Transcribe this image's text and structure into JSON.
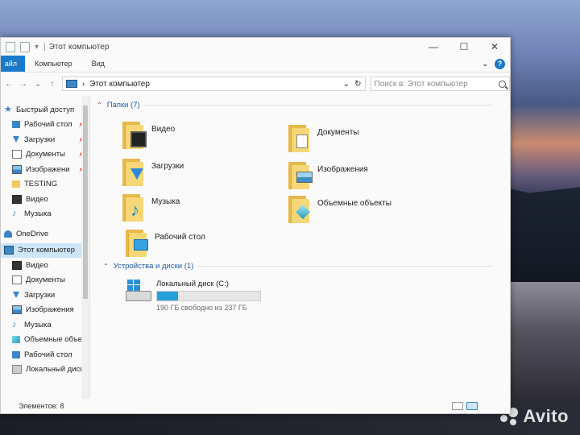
{
  "window": {
    "title": "Этот компьютер"
  },
  "ribbon": {
    "file_tab": "айл",
    "tabs": [
      "Компьютер",
      "Вид"
    ],
    "help": "?"
  },
  "address": {
    "path": "Этот компьютер"
  },
  "search": {
    "placeholder": "Поиск в: Этот компьютер"
  },
  "nav": {
    "quick_access": "Быстрый доступ",
    "quick_items": [
      {
        "label": "Рабочий стол",
        "icon": "desktop-icon"
      },
      {
        "label": "Загрузки",
        "icon": "download-icon"
      },
      {
        "label": "Документы",
        "icon": "document-icon"
      },
      {
        "label": "Изображени",
        "icon": "image-icon"
      },
      {
        "label": "TESTING",
        "icon": "folder-icon"
      },
      {
        "label": "Видео",
        "icon": "video-icon"
      },
      {
        "label": "Музыка",
        "icon": "music-icon"
      }
    ],
    "onedrive": "OneDrive",
    "this_pc": "Этот компьютер",
    "pc_items": [
      {
        "label": "Видео",
        "icon": "video-icon"
      },
      {
        "label": "Документы",
        "icon": "document-icon"
      },
      {
        "label": "Загрузки",
        "icon": "download-icon"
      },
      {
        "label": "Изображения",
        "icon": "image-icon"
      },
      {
        "label": "Музыка",
        "icon": "music-icon"
      },
      {
        "label": "Объемные объе",
        "icon": "3d-objects-icon"
      },
      {
        "label": "Рабочий стол",
        "icon": "desktop-icon"
      },
      {
        "label": "Локальный диск",
        "icon": "disk-icon"
      }
    ]
  },
  "folders_group": {
    "header": "Папки (7)"
  },
  "folders": [
    {
      "label": "Видео",
      "icon": "video-folder-icon"
    },
    {
      "label": "Документы",
      "icon": "documents-folder-icon"
    },
    {
      "label": "Загрузки",
      "icon": "downloads-folder-icon"
    },
    {
      "label": "Изображения",
      "icon": "pictures-folder-icon"
    },
    {
      "label": "Музыка",
      "icon": "music-folder-icon"
    },
    {
      "label": "Объемные объекты",
      "icon": "3d-objects-folder-icon"
    },
    {
      "label": "Рабочий стол",
      "icon": "desktop-folder-icon"
    }
  ],
  "devices_group": {
    "header": "Устройства и диски (1)"
  },
  "drive": {
    "label": "Локальный диск (C:)",
    "free_text": "190 ГБ свободно из 237 ГБ",
    "used_fraction": 0.2
  },
  "status": {
    "items_count": "Элементов: 8"
  },
  "watermark": "Avito"
}
